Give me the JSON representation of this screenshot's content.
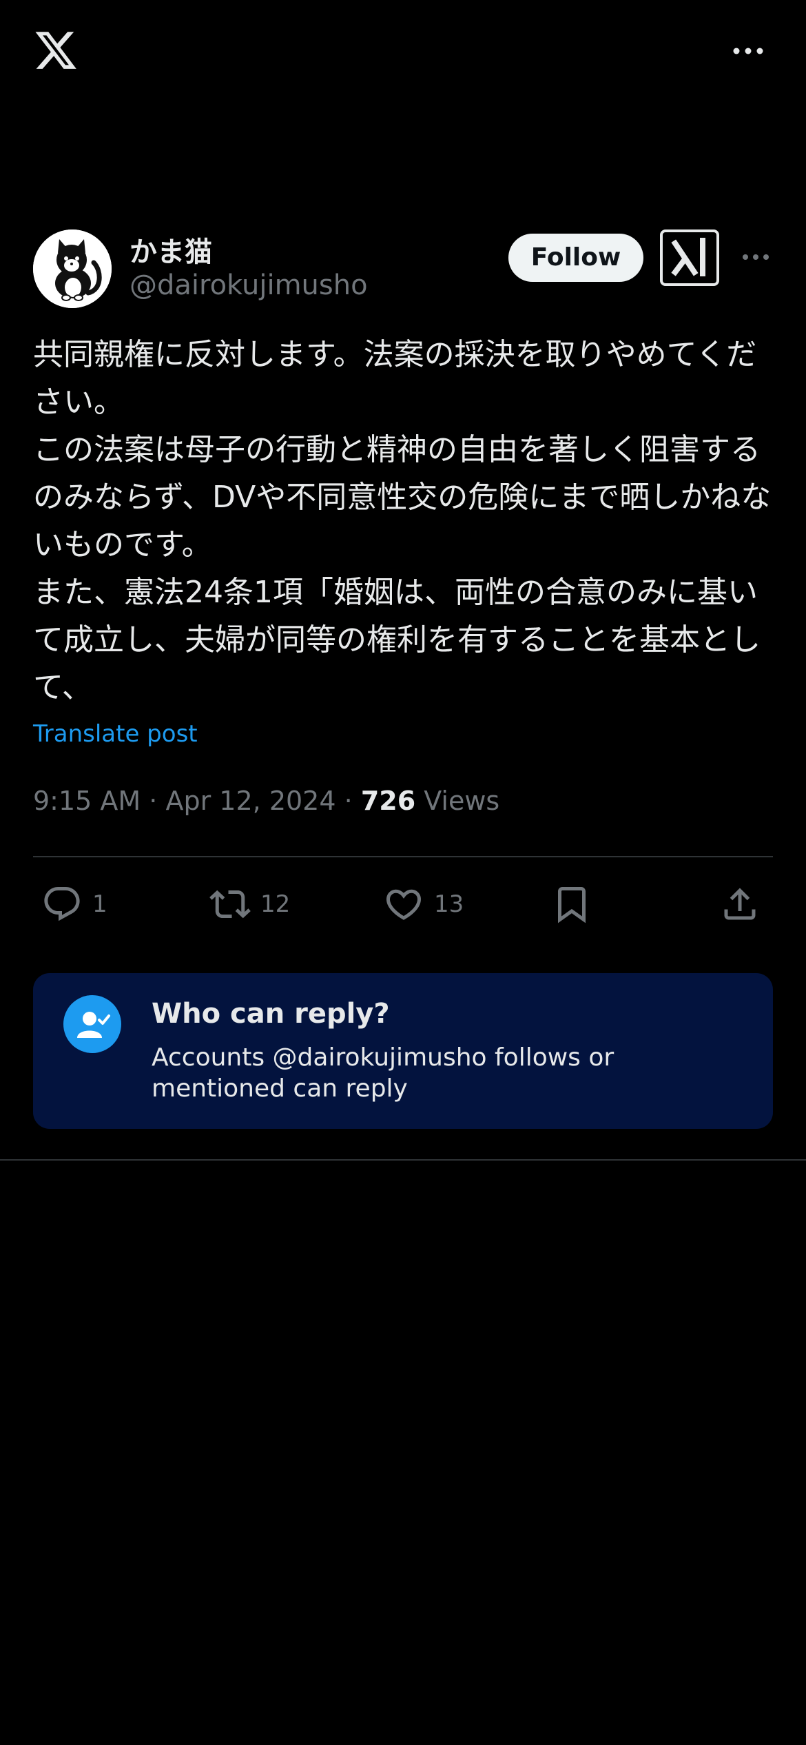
{
  "tweet": {
    "author": {
      "display_name": "かま猫",
      "handle": "@dairokujimusho"
    },
    "follow_label": "Follow",
    "text": "共同親権に反対します。法案の採決を取りやめてください。\nこの法案は母子の行動と精神の自由を著しく阻害するのみならず、DVや不同意性交の危険にまで晒しかねないものです。\nまた、憲法24条1項「婚姻は、両性の合意のみに基いて成立し、夫婦が同等の権利を有することを基本として、",
    "translate_label": "Translate post",
    "time": "9:15 AM",
    "separator": "·",
    "date": "Apr 12, 2024",
    "views_count": "726",
    "views_label": "Views"
  },
  "actions": {
    "replies": "1",
    "reposts": "12",
    "likes": "13"
  },
  "reply_restriction": {
    "title": "Who can reply?",
    "description": "Accounts @dairokujimusho follows or mentioned can reply"
  },
  "colors": {
    "background": "#000000",
    "text": "#e7e9ea",
    "muted": "#71767b",
    "accent": "#1d9bf0",
    "card": "#03133e"
  },
  "icons": [
    "x-logo-icon",
    "more-icon",
    "grok-icon",
    "reply-icon",
    "repost-icon",
    "like-icon",
    "bookmark-icon",
    "share-icon",
    "person-check-icon"
  ]
}
